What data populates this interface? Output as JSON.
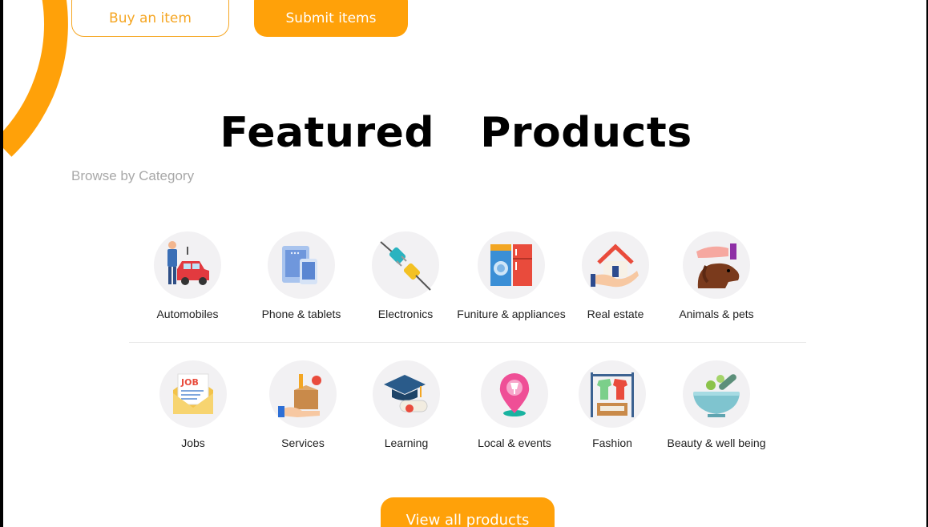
{
  "hero_buttons": {
    "buy_label": "Buy an item",
    "submit_label": "Submit items"
  },
  "section": {
    "title": "Featured  Products",
    "subtitle": "Browse by Category"
  },
  "categories_row1": [
    {
      "label": "Automobiles",
      "icon": "car-mechanic-icon"
    },
    {
      "label": "Phone & tablets",
      "icon": "phone-tablet-icon"
    },
    {
      "label": "Electronics",
      "icon": "plug-icon"
    },
    {
      "label": "Funiture & appliances",
      "icon": "appliances-icon"
    },
    {
      "label": "Real estate",
      "icon": "house-hand-icon"
    },
    {
      "label": "Animals & pets",
      "icon": "dog-hand-icon"
    }
  ],
  "categories_row2": [
    {
      "label": "Jobs",
      "icon": "job-envelope-icon"
    },
    {
      "label": "Services",
      "icon": "tools-box-icon"
    },
    {
      "label": "Learning",
      "icon": "graduation-cap-icon"
    },
    {
      "label": "Local & events",
      "icon": "location-pin-icon"
    },
    {
      "label": "Fashion",
      "icon": "clothes-rack-icon"
    },
    {
      "label": "Beauty & well being",
      "icon": "mortar-pestle-icon"
    }
  ],
  "footer_button": {
    "label": "View all products"
  },
  "colors": {
    "accent": "#ffa109",
    "outline": "#f5a623",
    "icon_bg": "#f2f1f3"
  }
}
